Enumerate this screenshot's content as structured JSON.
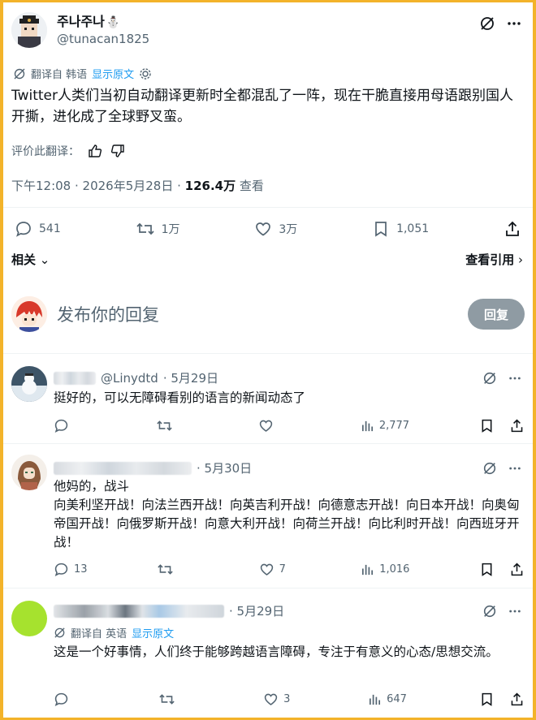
{
  "tweet": {
    "author_name": "주나주나",
    "author_handle": "@tunacan1825",
    "translate_prefix": "翻译自 韩语",
    "show_original": "显示原文",
    "text": "Twitter人类们当初自动翻译更新时全都混乱了一阵，现在干脆直接用母语跟别国人开撕，进化成了全球野叉蛮。",
    "rate_label": "评价此翻译：",
    "timestamp": "下午12:08 · 2026年5月28日 · ",
    "views": "126.4万",
    "views_label": " 查看",
    "stats": {
      "replies": "541",
      "retweets": "1万",
      "likes": "3万",
      "bookmarks": "1,051"
    }
  },
  "related_label": "相关",
  "quotes_label": "查看引用",
  "compose": {
    "placeholder": "发布你的回复",
    "button": "回复"
  },
  "replies": [
    {
      "handle": "@Linydtd",
      "date": "· 5月29日",
      "text": "挺好的，可以无障碍看别的语言的新闻动态了",
      "replies": "",
      "retweets": "",
      "likes": "",
      "views": "2,777"
    },
    {
      "handle": "",
      "date": "· 5月30日",
      "text": "他妈的，战斗\n向美利坚开战！向法兰西开战！向英吉利开战！向德意志开战！向日本开战！向奥匈帝国开战！向俄罗斯开战！向意大利开战！向荷兰开战！向比利时开战！向西班牙开战！",
      "replies": "13",
      "retweets": "",
      "likes": "7",
      "views": "1,016"
    },
    {
      "handle": "",
      "date": "· 5月29日",
      "translate_prefix": "翻译自 英语",
      "show_original": "显示原文",
      "text": "这是一个好事情，人们终于能够跨越语言障碍，专注于有意义的心态/思想交流。",
      "replies": "",
      "retweets": "",
      "likes": "3",
      "views": "647"
    }
  ],
  "colors": {
    "frame": "#f3b32a",
    "muted": "#536471",
    "link": "#1d9bf0",
    "button_disabled": "#8f9ba3"
  }
}
